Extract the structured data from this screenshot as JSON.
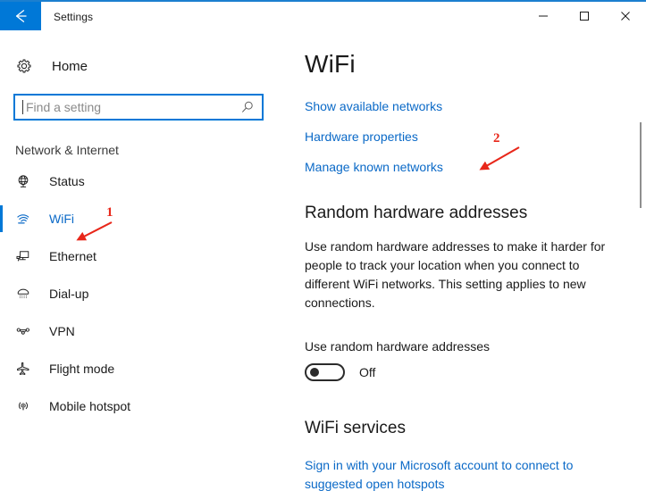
{
  "window": {
    "title": "Settings",
    "back_icon": "back-arrow-icon",
    "minimize_label": "–",
    "maximize_label": "□",
    "close_label": "✕",
    "accent_color": "#0078d7"
  },
  "sidebar": {
    "home": {
      "label": "Home",
      "icon": "gear-icon"
    },
    "search": {
      "value": "",
      "placeholder": "Find a setting",
      "icon": "search-icon"
    },
    "group_header": "Network & Internet",
    "items": [
      {
        "label": "Status",
        "icon": "globe-icon",
        "selected": false
      },
      {
        "label": "WiFi",
        "icon": "wifi-icon",
        "selected": true
      },
      {
        "label": "Ethernet",
        "icon": "ethernet-icon",
        "selected": false
      },
      {
        "label": "Dial-up",
        "icon": "dialup-phone-icon",
        "selected": false
      },
      {
        "label": "VPN",
        "icon": "vpn-icon",
        "selected": false
      },
      {
        "label": "Flight mode",
        "icon": "airplane-icon",
        "selected": false
      },
      {
        "label": "Mobile hotspot",
        "icon": "hotspot-icon",
        "selected": false
      }
    ]
  },
  "main": {
    "page_title": "WiFi",
    "links": [
      "Show available networks",
      "Hardware properties",
      "Manage known networks"
    ],
    "random_hw": {
      "section_title": "Random hardware addresses",
      "description": "Use random hardware addresses to make it harder for people to track your location when you connect to different WiFi networks. This setting applies to new connections.",
      "toggle_label": "Use random hardware addresses",
      "toggle_state": "Off",
      "toggle_on": false
    },
    "wifi_services": {
      "section_title": "WiFi services",
      "link": "Sign in with your Microsoft account to connect to suggested open hotspots"
    },
    "link_color": "#0a69c7"
  },
  "annotations": [
    {
      "number": "1",
      "color": "#e8271a",
      "target": "sidebar-item-wifi"
    },
    {
      "number": "2",
      "color": "#e8271a",
      "target": "link-manage-known-networks"
    }
  ]
}
